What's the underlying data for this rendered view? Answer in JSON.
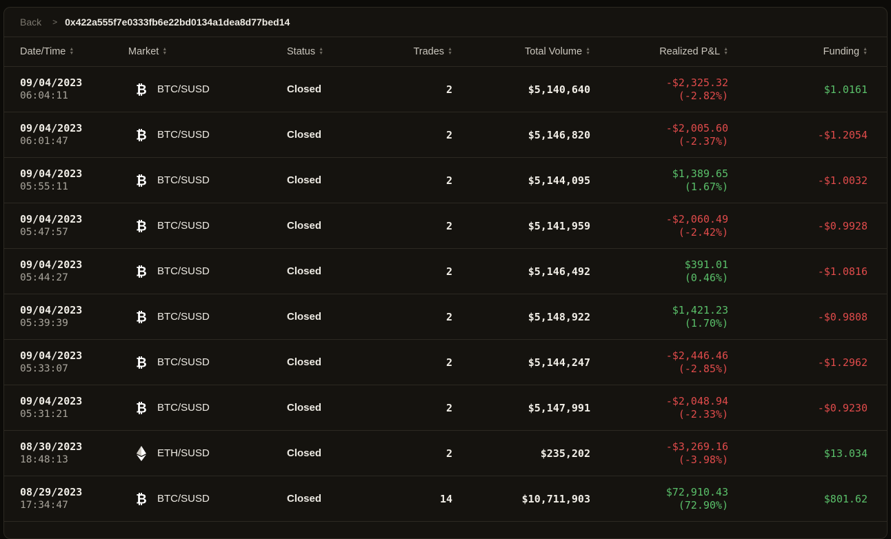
{
  "breadcrumb": {
    "back_label": "Back",
    "separator": ">",
    "address": "0x422a555f7e0333fb6e22bd0134a1dea8d77bed14"
  },
  "headers": {
    "datetime": "Date/Time",
    "market": "Market",
    "status": "Status",
    "trades": "Trades",
    "volume": "Total Volume",
    "pnl": "Realized P&L",
    "funding": "Funding"
  },
  "colors": {
    "positive": "#5ac06a",
    "negative": "#e04b4b"
  },
  "rows": [
    {
      "date": "09/04/2023",
      "time": "06:04:11",
      "market_icon": "bitcoin-icon",
      "market": "BTC/SUSD",
      "status": "Closed",
      "trades": "2",
      "volume": "$5,140,640",
      "pnl": "-$2,325.32",
      "pnl_pct": "(-2.82%)",
      "pnl_sign": "neg",
      "funding": "$1.0161",
      "funding_sign": "pos"
    },
    {
      "date": "09/04/2023",
      "time": "06:01:47",
      "market_icon": "bitcoin-icon",
      "market": "BTC/SUSD",
      "status": "Closed",
      "trades": "2",
      "volume": "$5,146,820",
      "pnl": "-$2,005.60",
      "pnl_pct": "(-2.37%)",
      "pnl_sign": "neg",
      "funding": "-$1.2054",
      "funding_sign": "neg"
    },
    {
      "date": "09/04/2023",
      "time": "05:55:11",
      "market_icon": "bitcoin-icon",
      "market": "BTC/SUSD",
      "status": "Closed",
      "trades": "2",
      "volume": "$5,144,095",
      "pnl": "$1,389.65",
      "pnl_pct": "(1.67%)",
      "pnl_sign": "pos",
      "funding": "-$1.0032",
      "funding_sign": "neg"
    },
    {
      "date": "09/04/2023",
      "time": "05:47:57",
      "market_icon": "bitcoin-icon",
      "market": "BTC/SUSD",
      "status": "Closed",
      "trades": "2",
      "volume": "$5,141,959",
      "pnl": "-$2,060.49",
      "pnl_pct": "(-2.42%)",
      "pnl_sign": "neg",
      "funding": "-$0.9928",
      "funding_sign": "neg"
    },
    {
      "date": "09/04/2023",
      "time": "05:44:27",
      "market_icon": "bitcoin-icon",
      "market": "BTC/SUSD",
      "status": "Closed",
      "trades": "2",
      "volume": "$5,146,492",
      "pnl": "$391.01",
      "pnl_pct": "(0.46%)",
      "pnl_sign": "pos",
      "funding": "-$1.0816",
      "funding_sign": "neg"
    },
    {
      "date": "09/04/2023",
      "time": "05:39:39",
      "market_icon": "bitcoin-icon",
      "market": "BTC/SUSD",
      "status": "Closed",
      "trades": "2",
      "volume": "$5,148,922",
      "pnl": "$1,421.23",
      "pnl_pct": "(1.70%)",
      "pnl_sign": "pos",
      "funding": "-$0.9808",
      "funding_sign": "neg"
    },
    {
      "date": "09/04/2023",
      "time": "05:33:07",
      "market_icon": "bitcoin-icon",
      "market": "BTC/SUSD",
      "status": "Closed",
      "trades": "2",
      "volume": "$5,144,247",
      "pnl": "-$2,446.46",
      "pnl_pct": "(-2.85%)",
      "pnl_sign": "neg",
      "funding": "-$1.2962",
      "funding_sign": "neg"
    },
    {
      "date": "09/04/2023",
      "time": "05:31:21",
      "market_icon": "bitcoin-icon",
      "market": "BTC/SUSD",
      "status": "Closed",
      "trades": "2",
      "volume": "$5,147,991",
      "pnl": "-$2,048.94",
      "pnl_pct": "(-2.33%)",
      "pnl_sign": "neg",
      "funding": "-$0.9230",
      "funding_sign": "neg"
    },
    {
      "date": "08/30/2023",
      "time": "18:48:13",
      "market_icon": "ethereum-icon",
      "market": "ETH/SUSD",
      "status": "Closed",
      "trades": "2",
      "volume": "$235,202",
      "pnl": "-$3,269.16",
      "pnl_pct": "(-3.98%)",
      "pnl_sign": "neg",
      "funding": "$13.034",
      "funding_sign": "pos"
    },
    {
      "date": "08/29/2023",
      "time": "17:34:47",
      "market_icon": "bitcoin-icon",
      "market": "BTC/SUSD",
      "status": "Closed",
      "trades": "14",
      "volume": "$10,711,903",
      "pnl": "$72,910.43",
      "pnl_pct": "(72.90%)",
      "pnl_sign": "pos",
      "funding": "$801.62",
      "funding_sign": "pos"
    }
  ]
}
